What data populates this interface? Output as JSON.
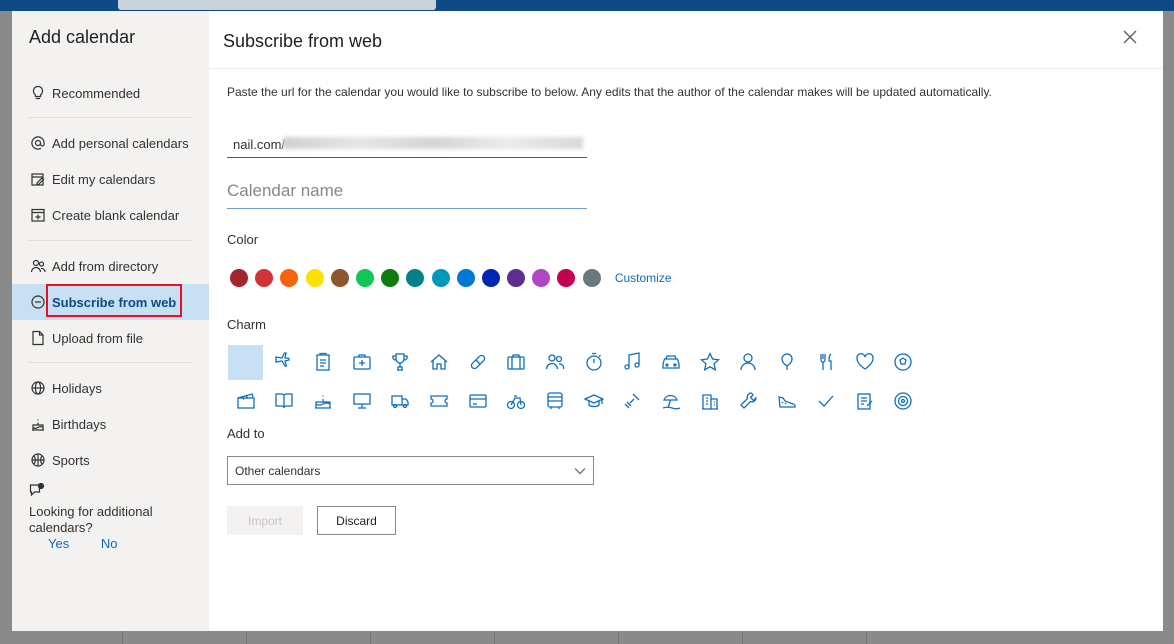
{
  "sidebar": {
    "title": "Add calendar",
    "items": [
      {
        "label": "Recommended",
        "icon": "lightbulb-icon"
      },
      {
        "label": "Add personal calendars",
        "icon": "at-sign-icon"
      },
      {
        "label": "Edit my calendars",
        "icon": "edit-calendar-icon"
      },
      {
        "label": "Create blank calendar",
        "icon": "calendar-add-icon"
      },
      {
        "label": "Add from directory",
        "icon": "people-icon"
      },
      {
        "label": "Subscribe from web",
        "icon": "globe-link-icon",
        "selected": true
      },
      {
        "label": "Upload from file",
        "icon": "document-icon"
      },
      {
        "label": "Holidays",
        "icon": "globe-icon"
      },
      {
        "label": "Birthdays",
        "icon": "cake-icon"
      },
      {
        "label": "Sports",
        "icon": "basketball-icon"
      }
    ],
    "help": {
      "question": "Looking for additional calendars?",
      "yes": "Yes",
      "no": "No"
    }
  },
  "main": {
    "title": "Subscribe from web",
    "description": "Paste the url for the calendar you would like to subscribe to below. Any edits that the author of the calendar makes will be updated automatically.",
    "url_value": "nail.com/",
    "name_placeholder": "Calendar name",
    "color_label": "Color",
    "colors": [
      "#a4262c",
      "#d13438",
      "#f7630c",
      "#fce100",
      "#8e562e",
      "#13c756",
      "#107c10",
      "#038387",
      "#0099bc",
      "#0078d4",
      "#0027b4",
      "#5c2e91",
      "#b146c2",
      "#c30052",
      "#69797e"
    ],
    "customize_label": "Customize",
    "charm_label": "Charm",
    "charms_row1": [
      "none",
      "airplane-icon",
      "clipboard-icon",
      "medical-bag-icon",
      "trophy-icon",
      "home-icon",
      "pill-icon",
      "briefcase-icon",
      "people-icon",
      "stopwatch-icon",
      "music-note-icon",
      "car-icon",
      "star-icon",
      "person-icon",
      "balloon-icon",
      "fork-knife-icon",
      "heart-icon",
      "soccer-ball-icon"
    ],
    "charms_row2": [
      "clapperboard-icon",
      "book-icon",
      "cake-icon",
      "monitor-icon",
      "truck-icon",
      "ticket-icon",
      "credit-card-icon",
      "bicycle-icon",
      "bus-icon",
      "graduation-cap-icon",
      "dumbbell-icon",
      "beach-icon",
      "buildings-icon",
      "wrench-icon",
      "sneaker-icon",
      "checkmark-icon",
      "notepad-icon",
      "target-icon"
    ],
    "add_to_label": "Add to",
    "add_to_value": "Other calendars",
    "import_label": "Import",
    "discard_label": "Discard"
  }
}
